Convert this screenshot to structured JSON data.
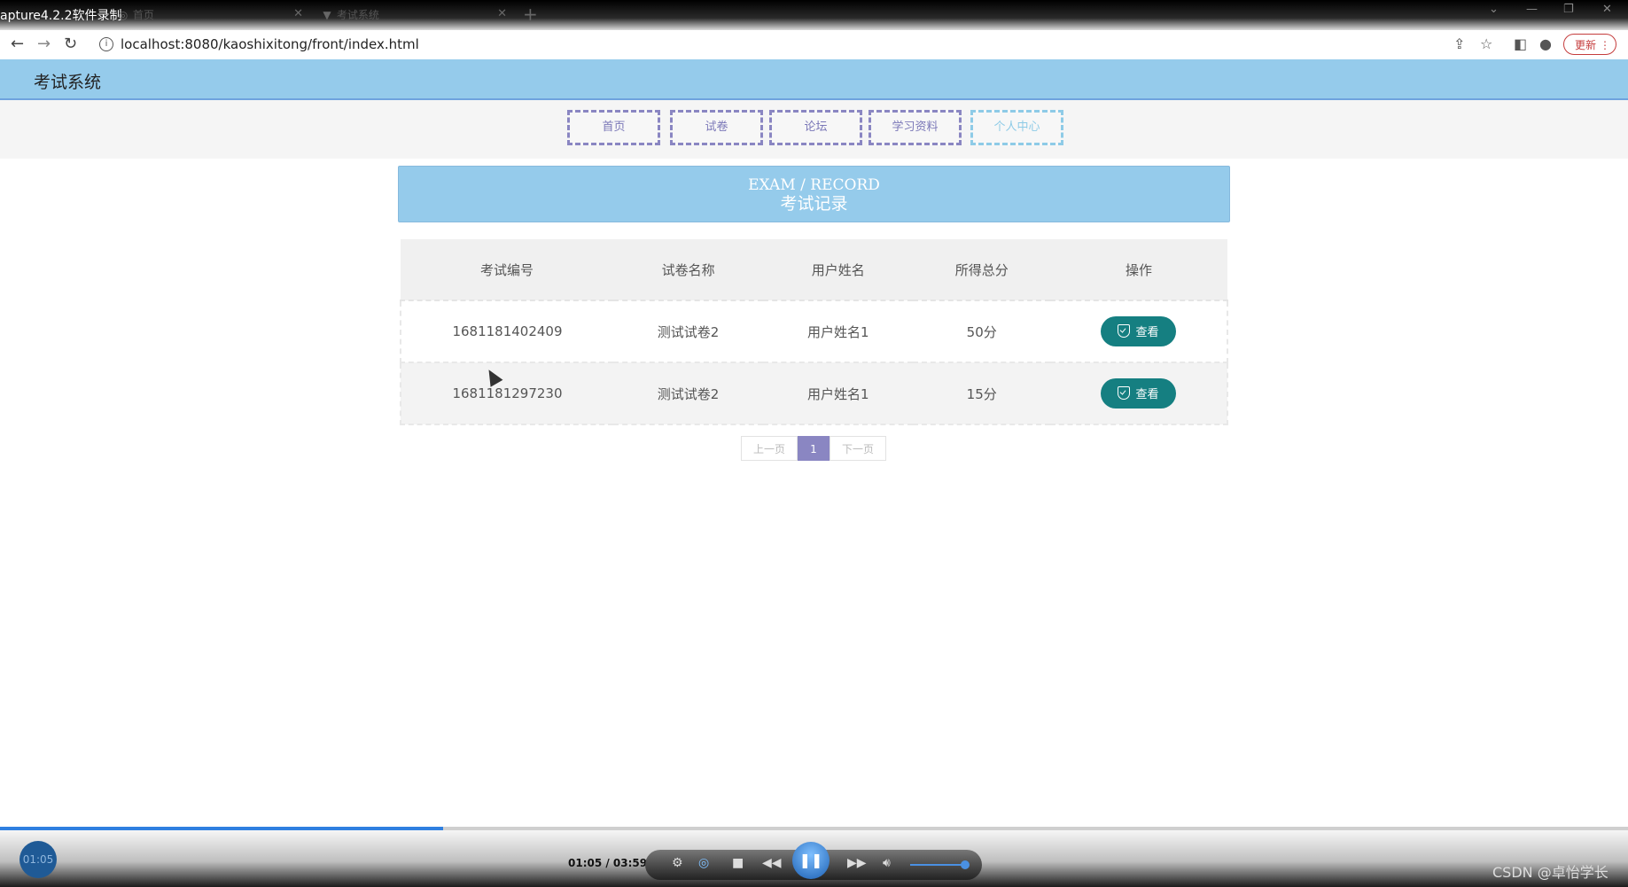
{
  "window": {
    "recorder_label": "apture4.2.2软件录制",
    "tabs": [
      {
        "title": "首页"
      },
      {
        "title": "考试系统"
      }
    ]
  },
  "browser": {
    "url": "localhost:8080/kaoshixitong/front/index.html",
    "update_label": "更新"
  },
  "site": {
    "title": "考试系统"
  },
  "nav": {
    "items": [
      {
        "label": "首页"
      },
      {
        "label": "试卷"
      },
      {
        "label": "论坛"
      },
      {
        "label": "学习资料"
      },
      {
        "label": "个人中心"
      }
    ]
  },
  "banner": {
    "en": "EXAM / RECORD",
    "zh": "考试记录"
  },
  "table": {
    "headers": [
      "考试编号",
      "试卷名称",
      "用户姓名",
      "所得总分",
      "操作"
    ],
    "rows": [
      {
        "id": "1681181402409",
        "paper": "测试试卷2",
        "user": "用户姓名1",
        "score": "50分",
        "action": "查看"
      },
      {
        "id": "1681181297230",
        "paper": "测试试卷2",
        "user": "用户姓名1",
        "score": "15分",
        "action": "查看"
      }
    ]
  },
  "pager": {
    "prev": "上一页",
    "current": "1",
    "next": "下一页"
  },
  "player": {
    "elapsed": "01:05",
    "readout": "01:05 / 03:59",
    "progress_fraction": 0.2721
  },
  "watermark": "CSDN @卓怡学长"
}
